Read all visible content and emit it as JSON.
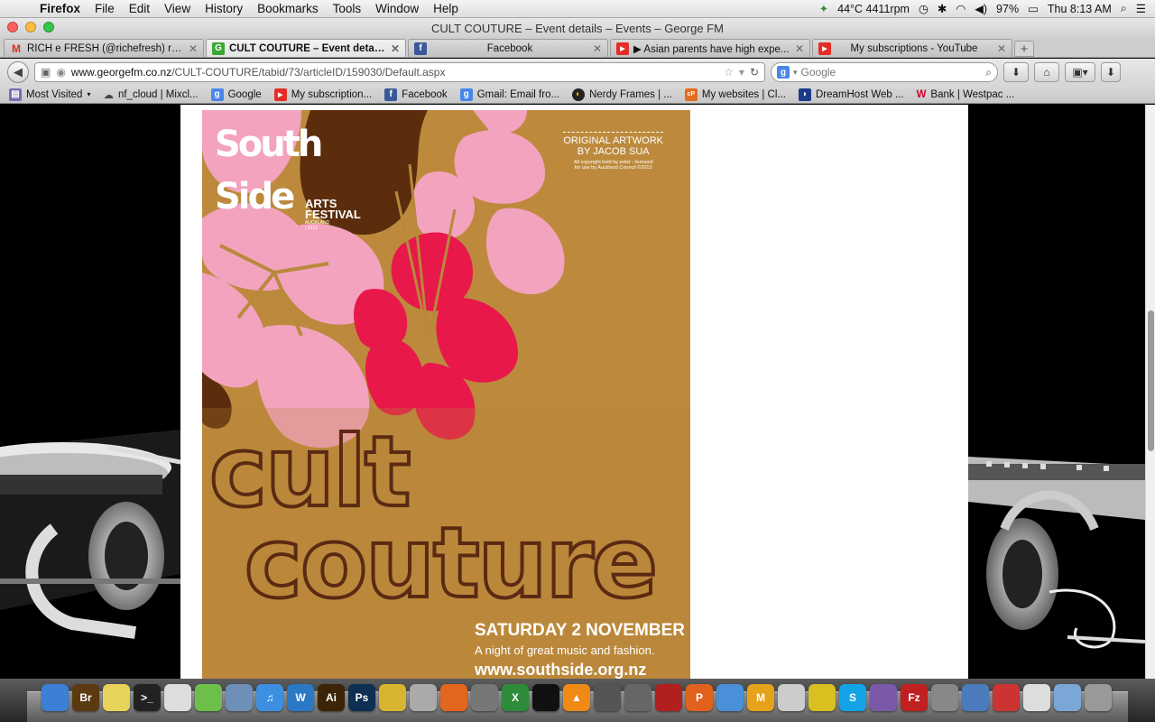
{
  "menubar": {
    "app": "Firefox",
    "items": [
      "File",
      "Edit",
      "View",
      "History",
      "Bookmarks",
      "Tools",
      "Window",
      "Help"
    ],
    "status_temp": "44°C 4411rpm",
    "battery": "97%",
    "clock": "Thu 8:13 AM"
  },
  "window": {
    "title": "CULT COUTURE – Event details – Events – George FM"
  },
  "tabs": [
    {
      "label": "RICH e FRESH (@richefresh) ret...",
      "favicon": "gmail-icon",
      "color": "#d93025"
    },
    {
      "label": "CULT COUTURE – Event details ...",
      "favicon": "georgefm-icon",
      "color": "#3aa833",
      "active": true
    },
    {
      "label": "Facebook",
      "favicon": "facebook-icon",
      "color": "#3b5998"
    },
    {
      "label": "▶ Asian parents have high expe...",
      "favicon": "youtube-icon",
      "color": "#e52d27"
    },
    {
      "label": "My subscriptions - YouTube",
      "favicon": "youtube-icon",
      "color": "#e52d27"
    }
  ],
  "nav": {
    "url_domain": "www.georgefm.co.nz",
    "url_path": "/CULT-COUTURE/tabid/73/articleID/159030/Default.aspx",
    "search_placeholder": "Google"
  },
  "bookmarks": [
    {
      "label": "Most Visited",
      "icon": "most-visited-icon"
    },
    {
      "label": "nf_cloud | Mixcl...",
      "icon": "mixcloud-icon"
    },
    {
      "label": "Google",
      "icon": "google-icon"
    },
    {
      "label": "My subscription...",
      "icon": "youtube-icon"
    },
    {
      "label": "Facebook",
      "icon": "facebook-icon"
    },
    {
      "label": "Gmail: Email fro...",
      "icon": "google-icon"
    },
    {
      "label": "Nerdy Frames | ...",
      "icon": "nerdy-frames-icon"
    },
    {
      "label": "My websites | Cl...",
      "icon": "cp-icon"
    },
    {
      "label": "DreamHost Web ...",
      "icon": "dreamhost-icon"
    },
    {
      "label": "Bank | Westpac ...",
      "icon": "westpac-icon"
    }
  ],
  "poster": {
    "logo_top": "South",
    "logo_bottom": "Side",
    "logo_arts": "ARTS",
    "logo_festival": "FESTIVAL",
    "logo_sub": "AUCKLAND | 2013",
    "credit_line1": "ORIGINAL ARTWORK",
    "credit_line2": "BY JACOB SUA",
    "credit_small1": "All copyright held by artist - licensed",
    "credit_small2": "for use by Auckland Council ©2013",
    "title1": "cult",
    "title2": "couture",
    "date": "SATURDAY 2 NOVEMBER",
    "tagline": "A night of great music and fashion.",
    "website": "www.southside.org.nz"
  },
  "dock": [
    {
      "name": "finder-icon",
      "label": "",
      "color": "#3b7fd6"
    },
    {
      "name": "bridge-icon",
      "label": "Br",
      "color": "#5b3a12"
    },
    {
      "name": "stickies-icon",
      "label": "",
      "color": "#e8d35a"
    },
    {
      "name": "terminal-icon",
      "label": ">_",
      "color": "#222"
    },
    {
      "name": "textedit-icon",
      "label": "",
      "color": "#ddd"
    },
    {
      "name": "app-green-icon",
      "label": "",
      "color": "#6cc04a"
    },
    {
      "name": "preview-icon",
      "label": "",
      "color": "#6d8fb8"
    },
    {
      "name": "itunes-icon",
      "label": "♫",
      "color": "#3d8fe0"
    },
    {
      "name": "word-icon",
      "label": "W",
      "color": "#2b78c5"
    },
    {
      "name": "illustrator-icon",
      "label": "Ai",
      "color": "#3b2407"
    },
    {
      "name": "photoshop-icon",
      "label": "Ps",
      "color": "#0d2f52"
    },
    {
      "name": "cyberduck-icon",
      "label": "",
      "color": "#d8b530"
    },
    {
      "name": "drive-icon",
      "label": "",
      "color": "#aaa"
    },
    {
      "name": "firefox-icon",
      "label": "",
      "color": "#e2661d"
    },
    {
      "name": "calculator-icon",
      "label": "",
      "color": "#777"
    },
    {
      "name": "excel-icon",
      "label": "X",
      "color": "#2e8b3a"
    },
    {
      "name": "ableton-live-icon",
      "label": "",
      "color": "#111"
    },
    {
      "name": "vlc-icon",
      "label": "▲",
      "color": "#f08a15"
    },
    {
      "name": "unity-icon",
      "label": "",
      "color": "#555"
    },
    {
      "name": "app-gray-icon",
      "label": "",
      "color": "#666"
    },
    {
      "name": "photo-booth-icon",
      "label": "",
      "color": "#b21f1f"
    },
    {
      "name": "app-orange-icon",
      "label": "P",
      "color": "#e0621e"
    },
    {
      "name": "safari-icon",
      "label": "",
      "color": "#4a90d9"
    },
    {
      "name": "mixed-in-key-icon",
      "label": "M",
      "color": "#e6a21a"
    },
    {
      "name": "app-music-icon",
      "label": "",
      "color": "#ccc"
    },
    {
      "name": "radiation-icon",
      "label": "",
      "color": "#d8c020"
    },
    {
      "name": "skype-icon",
      "label": "S",
      "color": "#14a3e6"
    },
    {
      "name": "app-purple-icon",
      "label": "",
      "color": "#7a5aa8"
    },
    {
      "name": "filezilla-icon",
      "label": "Fz",
      "color": "#c02020"
    },
    {
      "name": "system-preferences-icon",
      "label": "",
      "color": "#888"
    },
    {
      "name": "app-blue-icon",
      "label": "",
      "color": "#4a7cbc"
    },
    {
      "name": "app-red-icon",
      "label": "",
      "color": "#c33"
    },
    {
      "name": "documents-icon",
      "label": "",
      "color": "#ddd"
    },
    {
      "name": "downloads-icon",
      "label": "",
      "color": "#7aa7d8"
    },
    {
      "name": "trash-icon",
      "label": "",
      "color": "#999"
    }
  ]
}
